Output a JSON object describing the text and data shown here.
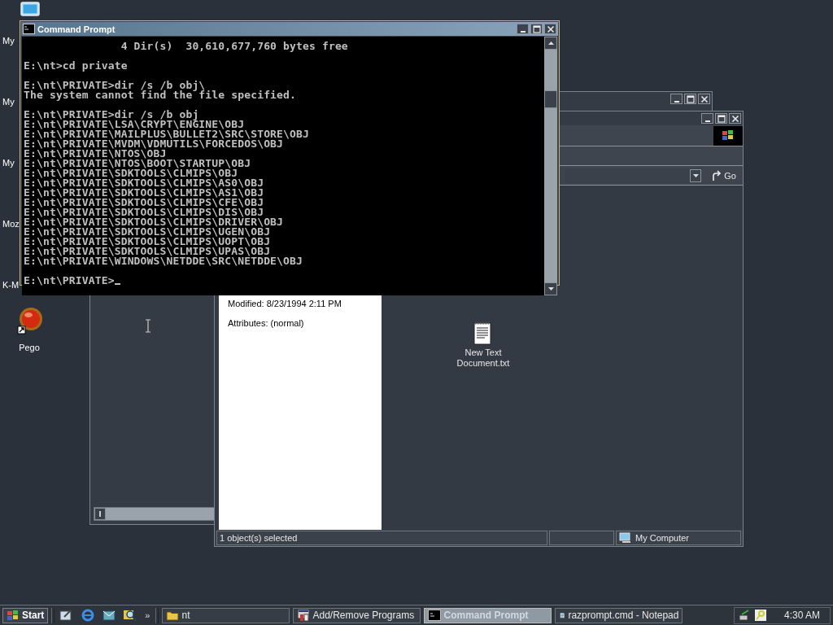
{
  "desktop_icons": [
    {
      "kind": "computer",
      "label": "My"
    },
    {
      "kind": "label_only",
      "label": "My"
    },
    {
      "kind": "label_only",
      "label": "My"
    },
    {
      "kind": "label_only",
      "label": "Moz"
    },
    {
      "kind": "label_only",
      "label": "K-M"
    },
    {
      "kind": "ball",
      "label": "Pego"
    }
  ],
  "command_prompt": {
    "title": "Command Prompt",
    "active": true,
    "blocks": [
      [
        "               4 Dir(s)  30,610,677,760 bytes free"
      ],
      [
        "E:\\nt>cd private"
      ],
      [
        "E:\\nt\\PRIVATE>dir /s /b obj\\",
        "The system cannot find the file specified."
      ],
      [
        "E:\\nt\\PRIVATE>dir /s /b obj",
        "E:\\nt\\PRIVATE\\LSA\\CRYPT\\ENGINE\\OBJ",
        "E:\\nt\\PRIVATE\\MAILPLUS\\BULLET2\\SRC\\STORE\\OBJ",
        "E:\\nt\\PRIVATE\\MVDM\\VDMUTILS\\FORCEDOS\\OBJ",
        "E:\\nt\\PRIVATE\\NTOS\\OBJ",
        "E:\\nt\\PRIVATE\\NTOS\\BOOT\\STARTUP\\OBJ",
        "E:\\nt\\PRIVATE\\SDKTOOLS\\CLMIPS\\OBJ",
        "E:\\nt\\PRIVATE\\SDKTOOLS\\CLMIPS\\AS0\\OBJ",
        "E:\\nt\\PRIVATE\\SDKTOOLS\\CLMIPS\\AS1\\OBJ",
        "E:\\nt\\PRIVATE\\SDKTOOLS\\CLMIPS\\CFE\\OBJ",
        "E:\\nt\\PRIVATE\\SDKTOOLS\\CLMIPS\\DIS\\OBJ",
        "E:\\nt\\PRIVATE\\SDKTOOLS\\CLMIPS\\DRIVER\\OBJ",
        "E:\\nt\\PRIVATE\\SDKTOOLS\\CLMIPS\\UGEN\\OBJ",
        "E:\\nt\\PRIVATE\\SDKTOOLS\\CLMIPS\\UOPT\\OBJ",
        "E:\\nt\\PRIVATE\\SDKTOOLS\\CLMIPS\\UPAS\\OBJ",
        "E:\\nt\\PRIVATE\\WINDOWS\\NETDDE\\SRC\\NETDDE\\OBJ"
      ],
      [
        "E:\\nt\\PRIVATE>"
      ]
    ]
  },
  "explorer": {
    "go_button": "Go",
    "details": [
      "Modified: 8/23/1994 2:11 PM",
      "Attributes: (normal)"
    ],
    "files": [
      {
        "name": "New Text Document.txt"
      }
    ],
    "status_bar": {
      "text": "1 object(s) selected",
      "zone": "My Computer"
    }
  },
  "taskbar": {
    "start": "Start",
    "chevron": "»",
    "tasks": [
      {
        "kind": "folder",
        "label": "nt",
        "selected": false
      },
      {
        "kind": "installer",
        "label": "Add/Remove Programs",
        "selected": false
      },
      {
        "kind": "console",
        "label": "Command Prompt",
        "selected": true
      },
      {
        "kind": "notepad",
        "label": "razprompt.cmd - Notepad",
        "selected": false
      }
    ],
    "clock": "4:30 AM"
  }
}
